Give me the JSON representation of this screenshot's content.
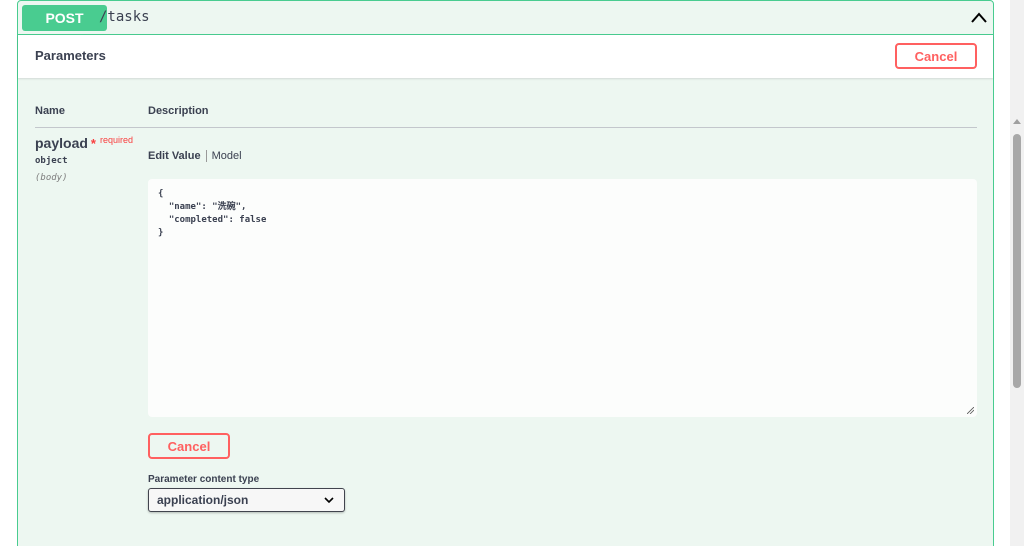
{
  "operation": {
    "method": "POST",
    "path": "/tasks"
  },
  "parameters_section": {
    "title": "Parameters",
    "cancel_label": "Cancel"
  },
  "table": {
    "col_name": "Name",
    "col_description": "Description"
  },
  "param": {
    "name": "payload",
    "required_star": "*",
    "required_text": "required",
    "type": "object",
    "in": "(body)"
  },
  "tabs": {
    "edit_value": "Edit Value",
    "model": "Model"
  },
  "editor": {
    "value": "{\n  \"name\": \"洗碗\",\n  \"completed\": false\n}"
  },
  "body_cancel_label": "Cancel",
  "content_type": {
    "label": "Parameter content type",
    "selected": "application/json"
  },
  "colors": {
    "post_green": "#49cc90",
    "cancel_red": "#ff6060",
    "required_red": "#f93e3e"
  },
  "icons": {
    "collapse": "chevron-up-icon",
    "select": "chevron-down-icon",
    "resize": "resize-grip-icon"
  }
}
